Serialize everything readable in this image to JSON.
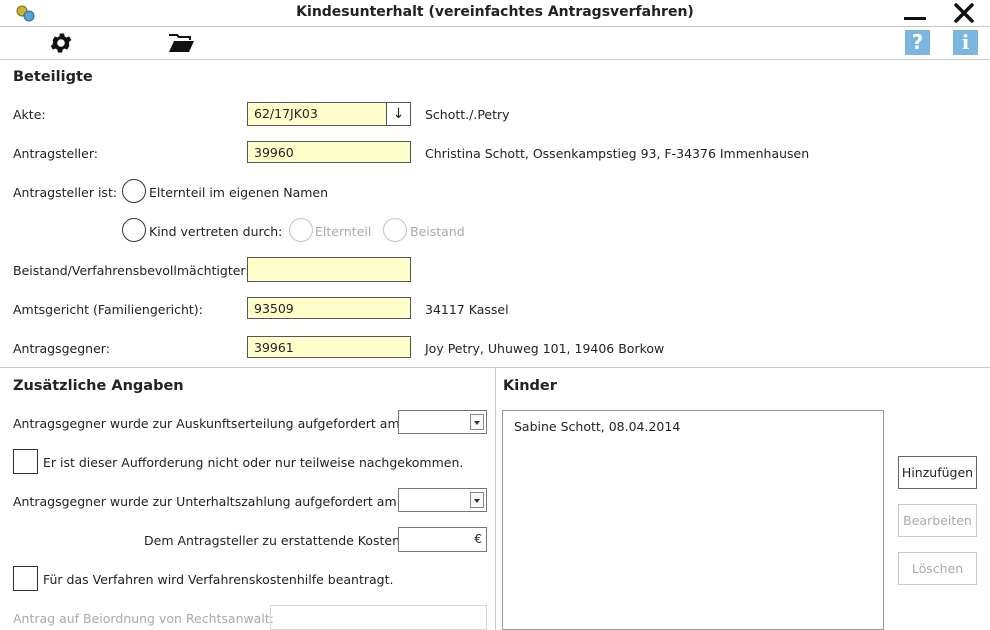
{
  "window": {
    "title": "Kindesunterhalt (vereinfachtes Antragsverfahren)"
  },
  "toolbar": {
    "settings_icon": "gear-icon",
    "open_icon": "folder-open-icon",
    "help_icon": "help-icon",
    "info_icon": "info-icon"
  },
  "beteiligte": {
    "title": "Beteiligte",
    "akte": {
      "label": "Akte:",
      "value": "62/17JK03",
      "picker": "↓",
      "info": "Schott./.Petry"
    },
    "antragsteller": {
      "label": "Antragsteller:",
      "value": "39960",
      "info": "Christina Schott, Ossenkampstieg 93, F-34376 Immenhausen"
    },
    "antragsteller_ist": {
      "label": "Antragsteller ist:",
      "option_elternteil": "Elternteil im eigenen Namen",
      "option_kind": "Kind vertreten durch:",
      "sub_elternteil": "Elternteil",
      "sub_beistand": "Beistand"
    },
    "beistand": {
      "label": "Beistand/Verfahrensbevollmächtigter:",
      "value": ""
    },
    "amtsgericht": {
      "label": "Amtsgericht (Familiengericht):",
      "value": "93509",
      "info": "34117 Kassel"
    },
    "antragsgegner": {
      "label": "Antragsgegner:",
      "value": "39961",
      "info": "Joy Petry, Uhuweg 101, 19406 Borkow"
    }
  },
  "zusatz": {
    "title": "Zusätzliche Angaben",
    "auskunft_label": "Antragsgegner wurde zur Auskunftserteilung aufgefordert am:",
    "nicht_nachgekommen": "Er ist dieser Aufforderung nicht oder nur teilweise nachgekommen.",
    "unterhalt_label": "Antragsgegner wurde zur Unterhaltszahlung aufgefordert am:",
    "kosten_label": "Dem Antragsteller zu erstattende Kosten:",
    "kosten_currency": "€",
    "vkh": "Für das Verfahren wird Verfahrenskostenhilfe beantragt.",
    "beiordnung_label": "Antrag auf Beiordnung von Rechtsanwalt:"
  },
  "kinder": {
    "title": "Kinder",
    "items": [
      "Sabine Schott, 08.04.2014"
    ],
    "add": "Hinzufügen",
    "edit": "Bearbeiten",
    "delete": "Löschen"
  }
}
